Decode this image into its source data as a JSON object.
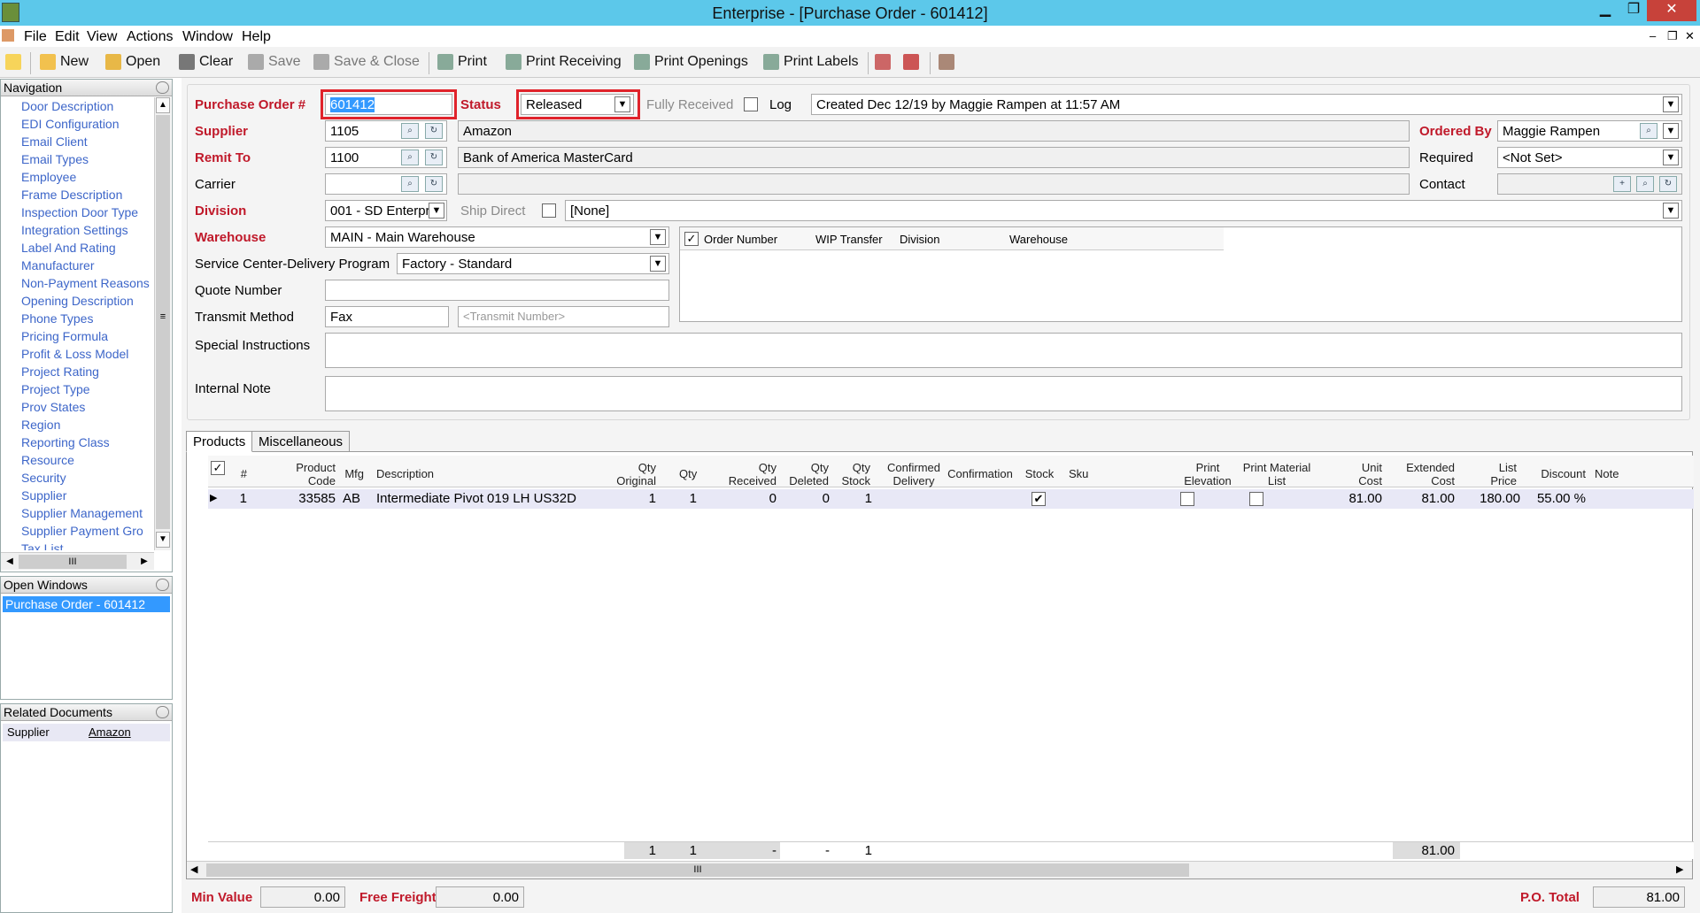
{
  "window": {
    "title": "Enterprise - [Purchase Order - 601412]",
    "min": "▁",
    "restore": "❐",
    "close": "✕",
    "mdi_min": "–",
    "mdi_restore": "❐",
    "mdi_close": "✕"
  },
  "menu": [
    "File",
    "Edit",
    "View",
    "Actions",
    "Window",
    "Help"
  ],
  "toolbar": {
    "new": "New",
    "open": "Open",
    "clear": "Clear",
    "save": "Save",
    "save_close": "Save & Close",
    "print": "Print",
    "print_receiving": "Print Receiving",
    "print_openings": "Print Openings",
    "print_labels": "Print Labels"
  },
  "navigation": {
    "title": "Navigation",
    "items": [
      "Door Description",
      "EDI Configuration",
      "Email Client",
      "Email Types",
      "Employee",
      "Frame Description",
      "Inspection Door Type",
      "Integration Settings",
      "Label And Rating",
      "Manufacturer",
      "Non-Payment Reasons",
      "Opening Description",
      "Phone Types",
      "Pricing Formula",
      "Profit & Loss Model",
      "Project Rating",
      "Project Type",
      "Prov States",
      "Region",
      "Reporting Class",
      "Resource",
      "Security",
      "Supplier",
      "Supplier Management",
      "Supplier Payment Gro",
      "Tax List"
    ],
    "scroll_thumb": "III"
  },
  "open_windows": {
    "title": "Open Windows",
    "items": [
      "Purchase Order - 601412"
    ]
  },
  "related_documents": {
    "title": "Related Documents",
    "rows": [
      {
        "type": "Supplier",
        "value": "Amazon"
      }
    ]
  },
  "form": {
    "po_label": "Purchase Order #",
    "po_value": "601412",
    "status_label": "Status",
    "status_value": "Released",
    "fully_received": "Fully Received",
    "log": "Log",
    "created": "Created Dec 12/19 by Maggie Rampen at 11:57 AM",
    "supplier_label": "Supplier",
    "supplier_code": "1105",
    "supplier_name": "Amazon",
    "remit_label": "Remit To",
    "remit_code": "1100",
    "remit_name": "Bank of America MasterCard",
    "carrier_label": "Carrier",
    "carrier_code": "",
    "carrier_name": "",
    "division_label": "Division",
    "division_value": "001 - SD Enterpr",
    "ship_direct": "Ship Direct",
    "ship_direct_value": "[None]",
    "warehouse_label": "Warehouse",
    "warehouse_value": "MAIN - Main Warehouse",
    "scdp_label": "Service Center-Delivery Program",
    "scdp_value": "Factory - Standard",
    "quote_label": "Quote Number",
    "quote_value": "",
    "transmit_label": "Transmit Method",
    "transmit_value": "Fax",
    "transmit_placeholder": "<Transmit Number>",
    "special_label": "Special Instructions",
    "internal_label": "Internal Note",
    "ordered_by_label": "Ordered By",
    "ordered_by_value": "Maggie Rampen",
    "required_label": "Required",
    "required_value": "<Not Set>",
    "contact_label": "Contact",
    "contact_value": ""
  },
  "order_grid": {
    "headers": [
      "Order Number",
      "WIP Transfer",
      "Division",
      "Warehouse"
    ]
  },
  "tabs": [
    "Products",
    "Miscellaneous"
  ],
  "products": {
    "headers": [
      "#",
      "Product Code",
      "Mfg",
      "Description",
      "Qty Original",
      "Qty",
      "Qty Received",
      "Qty Deleted",
      "Qty Stock",
      "Confirmed Delivery",
      "Confirmation",
      "Stock",
      "Sku",
      "Print Elevation",
      "Print Material List",
      "Unit Cost",
      "Extended Cost",
      "List Price",
      "Discount",
      "Note"
    ],
    "rows": [
      {
        "num": "1",
        "code": "33585",
        "mfg": "AB",
        "desc": "Intermediate Pivot 019 LH US32D",
        "qty_orig": "1",
        "qty": "1",
        "qty_recv": "0",
        "qty_del": "0",
        "qty_stock": "1",
        "stock": "✔",
        "unit": "81.00",
        "ext": "81.00",
        "list": "180.00",
        "disc": "55.00 %"
      }
    ],
    "totals": {
      "qty_orig": "1",
      "qty": "1",
      "qty_recv": "-",
      "qty_del": "-",
      "qty_stock": "1",
      "ext": "81.00"
    },
    "scroll_thumb": "III"
  },
  "footer": {
    "min_value_label": "Min Value",
    "min_value": "0.00",
    "free_freight_label": "Free Freight",
    "free_freight": "0.00",
    "po_total_label": "P.O. Total",
    "po_total": "81.00"
  }
}
